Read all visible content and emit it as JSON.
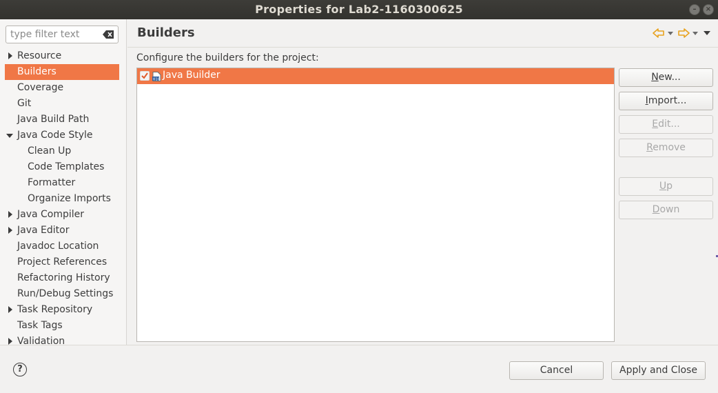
{
  "window": {
    "title": "Properties for Lab2-1160300625"
  },
  "filter": {
    "placeholder": "type filter text"
  },
  "tree": {
    "items": [
      {
        "label": "Resource",
        "expander": "collapsed",
        "level": 0
      },
      {
        "label": "Builders",
        "expander": "none",
        "level": 0,
        "selected": true
      },
      {
        "label": "Coverage",
        "expander": "none",
        "level": 0
      },
      {
        "label": "Git",
        "expander": "none",
        "level": 0
      },
      {
        "label": "Java Build Path",
        "expander": "none",
        "level": 0
      },
      {
        "label": "Java Code Style",
        "expander": "expanded",
        "level": 0
      },
      {
        "label": "Clean Up",
        "expander": "none",
        "level": 1
      },
      {
        "label": "Code Templates",
        "expander": "none",
        "level": 1
      },
      {
        "label": "Formatter",
        "expander": "none",
        "level": 1
      },
      {
        "label": "Organize Imports",
        "expander": "none",
        "level": 1
      },
      {
        "label": "Java Compiler",
        "expander": "collapsed",
        "level": 0
      },
      {
        "label": "Java Editor",
        "expander": "collapsed",
        "level": 0
      },
      {
        "label": "Javadoc Location",
        "expander": "none",
        "level": 0
      },
      {
        "label": "Project References",
        "expander": "none",
        "level": 0
      },
      {
        "label": "Refactoring History",
        "expander": "none",
        "level": 0
      },
      {
        "label": "Run/Debug Settings",
        "expander": "none",
        "level": 0
      },
      {
        "label": "Task Repository",
        "expander": "collapsed",
        "level": 0
      },
      {
        "label": "Task Tags",
        "expander": "none",
        "level": 0
      },
      {
        "label": "Validation",
        "expander": "collapsed",
        "level": 0
      }
    ]
  },
  "page": {
    "title": "Builders",
    "description": "Configure the builders for the project:"
  },
  "builders": [
    {
      "label": "Java Builder",
      "checked": true
    }
  ],
  "side_buttons": {
    "new": {
      "label": "New...",
      "mnemonic": "N",
      "rest": "ew...",
      "enabled": true
    },
    "import": {
      "label": "Import...",
      "mnemonic": "I",
      "rest": "mport...",
      "enabled": true
    },
    "edit": {
      "label": "Edit...",
      "mnemonic": "E",
      "rest": "dit...",
      "enabled": false
    },
    "remove": {
      "label": "Remove",
      "mnemonic": "R",
      "rest": "emove",
      "enabled": false
    },
    "up": {
      "label": "Up",
      "mnemonic": "U",
      "rest": "p",
      "enabled": false
    },
    "down": {
      "label": "Down",
      "mnemonic": "D",
      "rest": "own",
      "enabled": false
    }
  },
  "footer": {
    "help_label": "?",
    "cancel": "Cancel",
    "apply_close": "Apply and Close"
  },
  "colors": {
    "selection": "#f07746",
    "titlebar": "#3d3c38",
    "nav_arrow": "#e8a21e"
  },
  "icons": {
    "clear": "backspace-icon",
    "back": "back-arrow-icon",
    "forward": "forward-arrow-icon",
    "menu": "view-menu-icon",
    "builder": "java-builder-icon",
    "help": "help-icon"
  }
}
